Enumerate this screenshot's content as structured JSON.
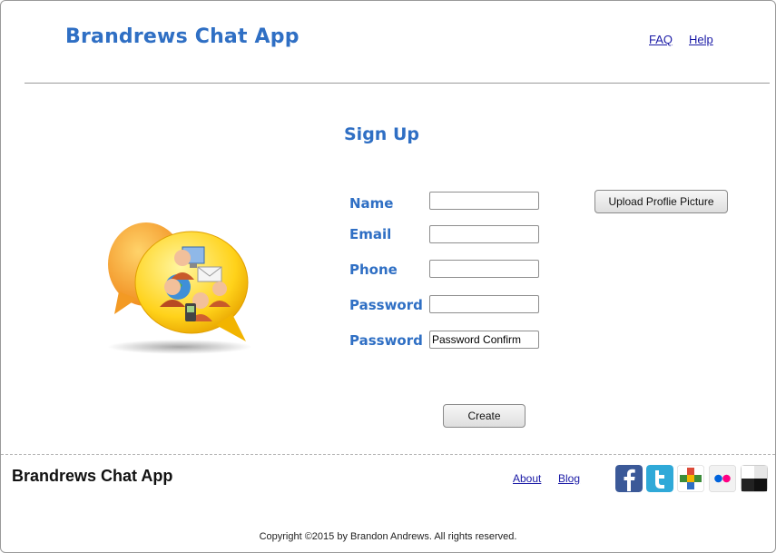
{
  "header": {
    "brand": "Brandrews Chat App",
    "links": [
      {
        "label": "FAQ"
      },
      {
        "label": "Help"
      }
    ]
  },
  "signup": {
    "title": "Sign Up",
    "fields": [
      {
        "label": "Name",
        "value": "",
        "placeholder": ""
      },
      {
        "label": "Email",
        "value": "",
        "placeholder": ""
      },
      {
        "label": "Phone",
        "value": "",
        "placeholder": ""
      },
      {
        "label": "Password",
        "value": "",
        "placeholder": ""
      },
      {
        "label": "Password",
        "value": "Password Confirm",
        "placeholder": ""
      }
    ],
    "upload_label": "Upload Proflie Picture",
    "create_label": "Create"
  },
  "footer": {
    "brand": "Brandrews Chat App",
    "links": [
      {
        "label": "About"
      },
      {
        "label": "Blog"
      }
    ],
    "social": [
      {
        "icon": "facebook-icon",
        "color": "#3b5998"
      },
      {
        "icon": "twitter-icon",
        "color": "#2fa9d8"
      },
      {
        "icon": "google-plus-icon",
        "color": "#dd4b39"
      },
      {
        "icon": "flickr-icon",
        "color": "#eaeaea"
      },
      {
        "icon": "delicious-icon",
        "color": "#222222"
      }
    ],
    "copyright": "Copyright ©2015 by Brandon Andrews. All rights reserved."
  }
}
